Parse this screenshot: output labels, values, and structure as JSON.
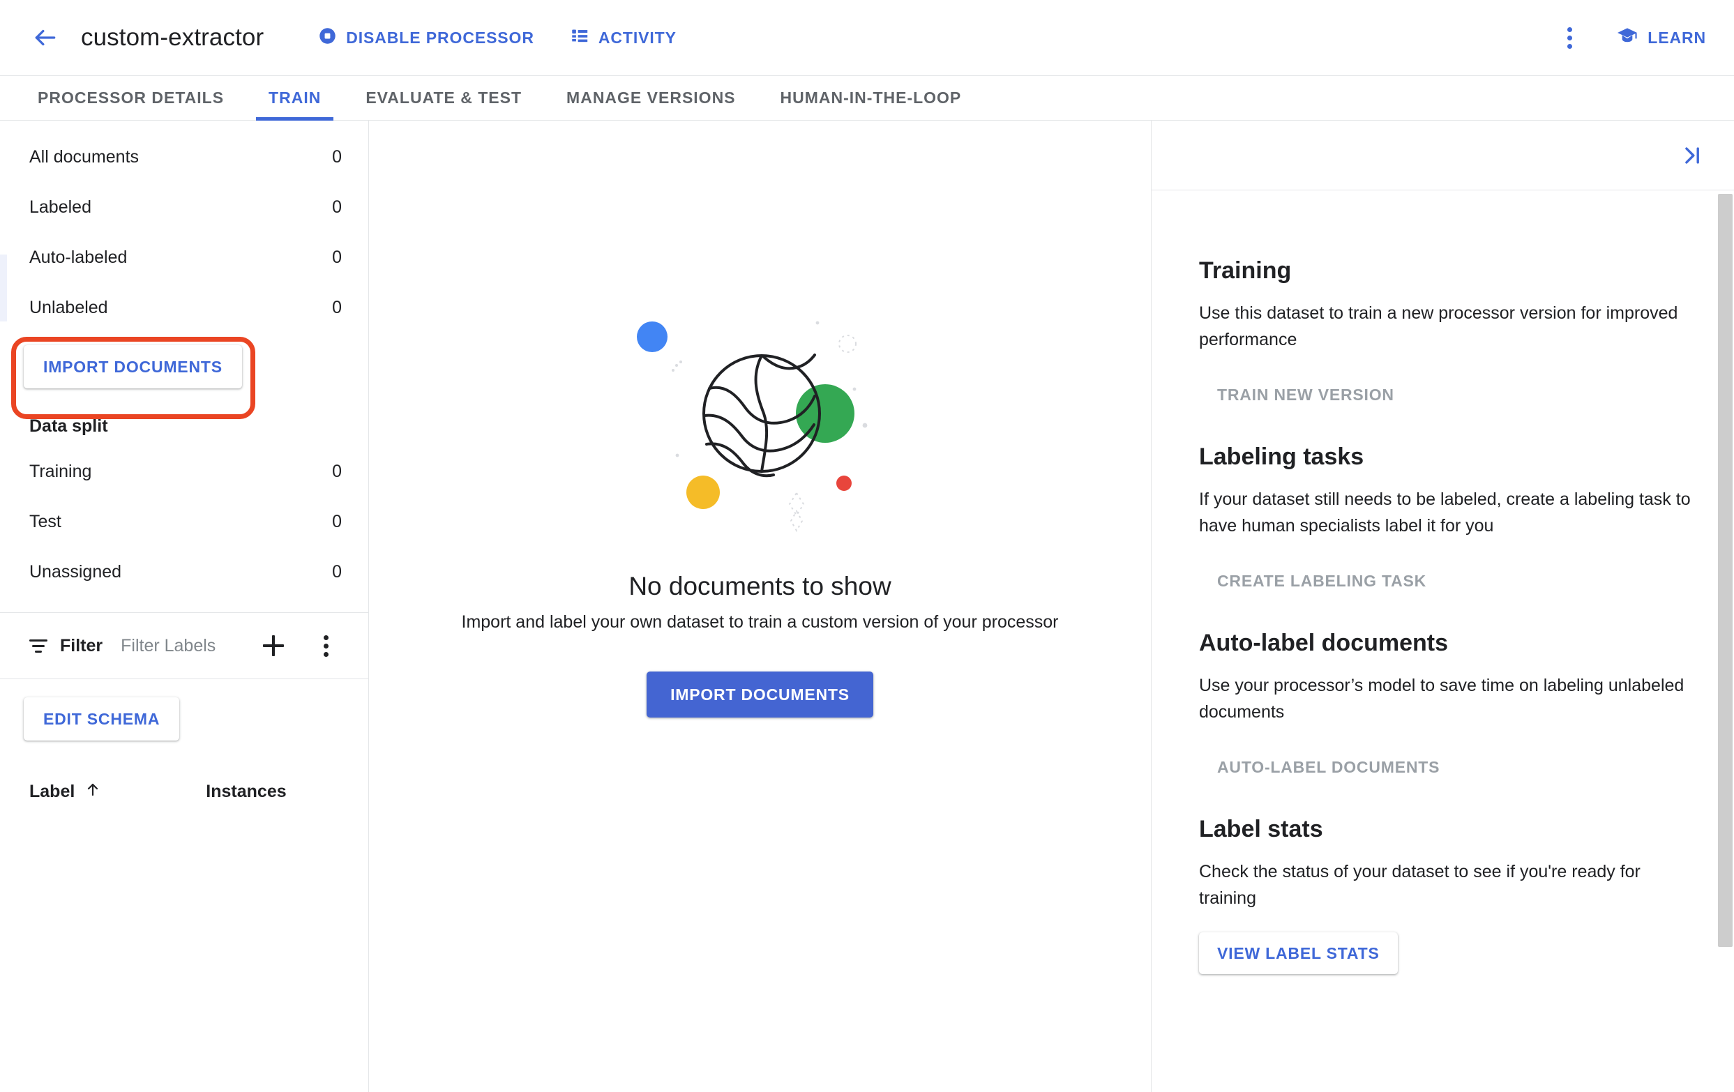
{
  "topbar": {
    "back_icon": "arrow-left-icon",
    "title": "custom-extractor",
    "disable_processor_label": "DISABLE PROCESSOR",
    "disable_processor_icon": "stop-circle-icon",
    "activity_label": "ACTIVITY",
    "activity_icon": "list-icon",
    "more_icon": "kebab-menu-icon",
    "learn_label": "LEARN",
    "learn_icon": "graduation-cap-icon"
  },
  "tabs": [
    {
      "label": "PROCESSOR DETAILS",
      "active": false
    },
    {
      "label": "TRAIN",
      "active": true
    },
    {
      "label": "EVALUATE & TEST",
      "active": false
    },
    {
      "label": "MANAGE VERSIONS",
      "active": false
    },
    {
      "label": "HUMAN-IN-THE-LOOP",
      "active": false
    }
  ],
  "sidebar": {
    "doc_counts": [
      {
        "label": "All documents",
        "value": "0"
      },
      {
        "label": "Labeled",
        "value": "0"
      },
      {
        "label": "Auto-labeled",
        "value": "0"
      },
      {
        "label": "Unlabeled",
        "value": "0"
      }
    ],
    "import_button_label": "IMPORT DOCUMENTS",
    "data_split_heading": "Data split",
    "data_split": [
      {
        "label": "Training",
        "value": "0"
      },
      {
        "label": "Test",
        "value": "0"
      },
      {
        "label": "Unassigned",
        "value": "0"
      }
    ],
    "filter": {
      "label": "Filter",
      "placeholder": "Filter Labels",
      "value": "",
      "filter_icon": "filter-icon",
      "add_icon": "plus-icon",
      "more_icon": "kebab-menu-icon"
    },
    "edit_schema_label": "EDIT SCHEMA",
    "table_headers": {
      "label": "Label",
      "sort_icon": "arrow-up-icon",
      "instances": "Instances"
    }
  },
  "main": {
    "illustration": "globe-sphere-illustration",
    "empty_title": "No documents to show",
    "empty_subtitle": "Import and label your own dataset to train a custom version of your processor",
    "import_button_label": "IMPORT DOCUMENTS"
  },
  "right_panel": {
    "collapse_icon": "collapse-panel-right-icon",
    "cards": [
      {
        "title": "Training",
        "description": "Use this dataset to train a new processor version for improved performance",
        "action_label": "TRAIN NEW VERSION",
        "action_state": "disabled"
      },
      {
        "title": "Labeling tasks",
        "description": "If your dataset still needs to be labeled, create a labeling task to have human specialists label it for you",
        "action_label": "CREATE LABELING TASK",
        "action_state": "disabled"
      },
      {
        "title": "Auto-label documents",
        "description": "Use your processor’s model to save time on labeling unlabeled documents",
        "action_label": "AUTO-LABEL DOCUMENTS",
        "action_state": "disabled"
      },
      {
        "title": "Label stats",
        "description": "Check the status of your dataset to see if you're ready for training",
        "action_label": "VIEW LABEL STATS",
        "action_state": "enabled"
      }
    ]
  },
  "annotation": {
    "type": "highlight-rectangle",
    "color": "#ea4523",
    "target": "IMPORT DOCUMENTS"
  },
  "colors": {
    "accent_blue": "#3f68d8",
    "primary_button": "#4465d2",
    "disabled_text": "#9aa0a6",
    "annotation_red": "#ea4523",
    "illustration_blue": "#4285f4",
    "illustration_green": "#34a853",
    "illustration_yellow": "#f5bc28",
    "illustration_red": "#e8453c"
  }
}
